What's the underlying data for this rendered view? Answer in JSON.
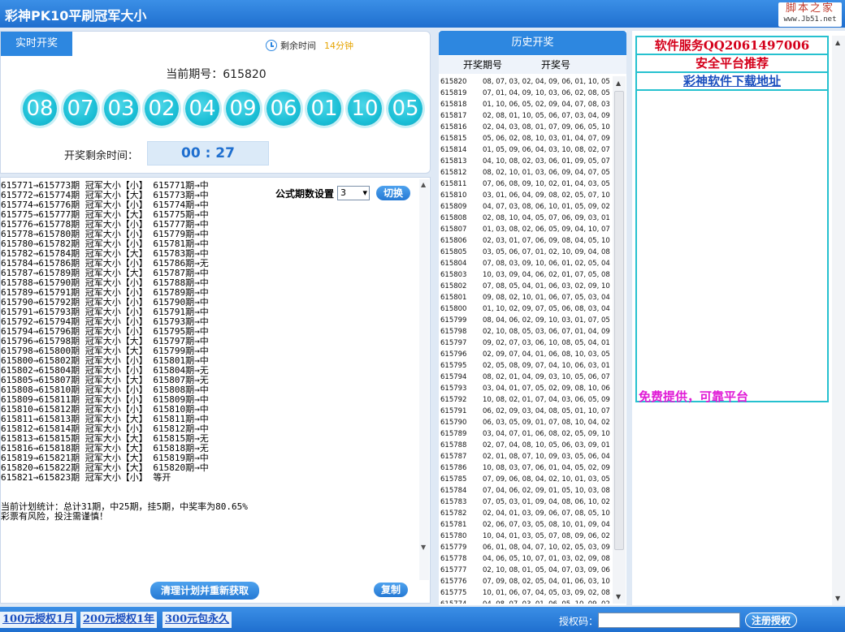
{
  "window": {
    "title": "彩神PK10平刷冠军大小",
    "logo_top": "脚本之家",
    "logo_bottom": "www.Jb51.net"
  },
  "live": {
    "tab_label": "实时开奖",
    "remain_label": "剩余时间",
    "remain_value": "14分钟",
    "current_issue": "当前期号：615820",
    "balls": [
      "08",
      "07",
      "03",
      "02",
      "04",
      "09",
      "06",
      "01",
      "10",
      "05"
    ],
    "countdown_label": "开奖剩余时间：",
    "countdown": "00 : 27"
  },
  "plan": {
    "lines": [
      "615771→615773期 冠军大小【小】 615771期→中",
      "615772→615774期 冠军大小【大】 615773期→中",
      "615774→615776期 冠军大小【小】 615774期→中",
      "615775→615777期 冠军大小【大】 615775期→中",
      "615776→615778期 冠军大小【小】 615777期→中",
      "615778→615780期 冠军大小【小】 615779期→中",
      "615780→615782期 冠军大小【小】 615781期→中",
      "615782→615784期 冠军大小【大】 615783期→中",
      "615784→615786期 冠军大小【小】 615786期→无",
      "615787→615789期 冠军大小【大】 615787期→中",
      "615788→615790期 冠军大小【小】 615788期→中",
      "615789→615791期 冠军大小【小】 615789期→中",
      "615790→615792期 冠军大小【小】 615790期→中",
      "615791→615793期 冠军大小【小】 615791期→中",
      "615792→615794期 冠军大小【小】 615793期→中",
      "615794→615796期 冠军大小【小】 615795期→中",
      "615796→615798期 冠军大小【大】 615797期→中",
      "615798→615800期 冠军大小【大】 615799期→中",
      "615800→615802期 冠军大小【小】 615801期→中",
      "615802→615804期 冠军大小【小】 615804期→无",
      "615805→615807期 冠军大小【大】 615807期→无",
      "615808→615810期 冠军大小【小】 615808期→中",
      "615809→615811期 冠军大小【小】 615809期→中",
      "615810→615812期 冠军大小【小】 615810期→中",
      "615811→615813期 冠军大小【大】 615811期→中",
      "615812→615814期 冠军大小【小】 615812期→中",
      "615813→615815期 冠军大小【大】 615815期→无",
      "615816→615818期 冠军大小【大】 615818期→无",
      "615819→615821期 冠军大小【大】 615819期→中",
      "615820→615822期 冠军大小【大】 615820期→中",
      "615821→615823期 冠军大小【小】 等开"
    ],
    "summary_1": "当前计划统计：总计31期，中25期，挂5期，中奖率为80.65%",
    "summary_2": "彩票有风险，投注需谨慎！",
    "formula_label": "公式期数设置",
    "formula_value": "3",
    "switch_label": "切换",
    "clear_label": "清理计划并重新获取",
    "copy_label": "复制"
  },
  "history": {
    "tab_label": "历史开奖",
    "col_issue": "开奖期号",
    "col_numbers": "开奖号",
    "rows": [
      [
        "615820",
        "08, 07, 03, 02, 04, 09, 06, 01, 10, 05"
      ],
      [
        "615819",
        "07, 01, 04, 09, 10, 03, 06, 02, 08, 05"
      ],
      [
        "615818",
        "01, 10, 06, 05, 02, 09, 04, 07, 08, 03"
      ],
      [
        "615817",
        "02, 08, 01, 10, 05, 06, 07, 03, 04, 09"
      ],
      [
        "615816",
        "02, 04, 03, 08, 01, 07, 09, 06, 05, 10"
      ],
      [
        "615815",
        "05, 06, 02, 08, 10, 03, 01, 04, 07, 09"
      ],
      [
        "615814",
        "01, 05, 09, 06, 04, 03, 10, 08, 02, 07"
      ],
      [
        "615813",
        "04, 10, 08, 02, 03, 06, 01, 09, 05, 07"
      ],
      [
        "615812",
        "08, 02, 10, 01, 03, 06, 09, 04, 07, 05"
      ],
      [
        "615811",
        "07, 06, 08, 09, 10, 02, 01, 04, 03, 05"
      ],
      [
        "615810",
        "03, 01, 06, 04, 09, 08, 02, 05, 07, 10"
      ],
      [
        "615809",
        "04, 07, 03, 08, 06, 10, 01, 05, 09, 02"
      ],
      [
        "615808",
        "02, 08, 10, 04, 05, 07, 06, 09, 03, 01"
      ],
      [
        "615807",
        "01, 03, 08, 02, 06, 05, 09, 04, 10, 07"
      ],
      [
        "615806",
        "02, 03, 01, 07, 06, 09, 08, 04, 05, 10"
      ],
      [
        "615805",
        "03, 05, 06, 07, 01, 02, 10, 09, 04, 08"
      ],
      [
        "615804",
        "07, 08, 03, 09, 10, 06, 01, 02, 05, 04"
      ],
      [
        "615803",
        "10, 03, 09, 04, 06, 02, 01, 07, 05, 08"
      ],
      [
        "615802",
        "07, 08, 05, 04, 01, 06, 03, 02, 09, 10"
      ],
      [
        "615801",
        "09, 08, 02, 10, 01, 06, 07, 05, 03, 04"
      ],
      [
        "615800",
        "01, 10, 02, 09, 07, 05, 06, 08, 03, 04"
      ],
      [
        "615799",
        "08, 04, 06, 02, 09, 10, 03, 01, 07, 05"
      ],
      [
        "615798",
        "02, 10, 08, 05, 03, 06, 07, 01, 04, 09"
      ],
      [
        "615797",
        "09, 02, 07, 03, 06, 10, 08, 05, 04, 01"
      ],
      [
        "615796",
        "02, 09, 07, 04, 01, 06, 08, 10, 03, 05"
      ],
      [
        "615795",
        "02, 05, 08, 09, 07, 04, 10, 06, 03, 01"
      ],
      [
        "615794",
        "08, 02, 01, 04, 09, 03, 10, 05, 06, 07"
      ],
      [
        "615793",
        "03, 04, 01, 07, 05, 02, 09, 08, 10, 06"
      ],
      [
        "615792",
        "10, 08, 02, 01, 07, 04, 03, 06, 05, 09"
      ],
      [
        "615791",
        "06, 02, 09, 03, 04, 08, 05, 01, 10, 07"
      ],
      [
        "615790",
        "06, 03, 05, 09, 01, 07, 08, 10, 04, 02"
      ],
      [
        "615789",
        "03, 04, 07, 01, 06, 08, 02, 05, 09, 10"
      ],
      [
        "615788",
        "02, 07, 04, 08, 10, 05, 06, 03, 09, 01"
      ],
      [
        "615787",
        "02, 01, 08, 07, 10, 09, 03, 05, 06, 04"
      ],
      [
        "615786",
        "10, 08, 03, 07, 06, 01, 04, 05, 02, 09"
      ],
      [
        "615785",
        "07, 09, 06, 08, 04, 02, 10, 01, 03, 05"
      ],
      [
        "615784",
        "07, 04, 06, 02, 09, 01, 05, 10, 03, 08"
      ],
      [
        "615783",
        "07, 05, 03, 01, 09, 04, 08, 06, 10, 02"
      ],
      [
        "615782",
        "02, 04, 01, 03, 09, 06, 07, 08, 05, 10"
      ],
      [
        "615781",
        "02, 06, 07, 03, 05, 08, 10, 01, 09, 04"
      ],
      [
        "615780",
        "10, 04, 01, 03, 05, 07, 08, 09, 06, 02"
      ],
      [
        "615779",
        "06, 01, 08, 04, 07, 10, 02, 05, 03, 09"
      ],
      [
        "615778",
        "04, 06, 05, 10, 07, 01, 03, 02, 09, 08"
      ],
      [
        "615777",
        "02, 10, 08, 01, 05, 04, 07, 03, 09, 06"
      ],
      [
        "615776",
        "07, 09, 08, 02, 05, 04, 01, 06, 03, 10"
      ],
      [
        "615775",
        "10, 01, 06, 07, 04, 05, 03, 09, 02, 08"
      ],
      [
        "615774",
        "04, 08, 07, 03, 01, 06, 05, 10, 09, 02"
      ]
    ]
  },
  "ads": {
    "line_1": "软件服务QQ2061497006",
    "line_2": "安全平台推荐",
    "line_3": "彩神软件下载地址",
    "free": "免费提供，可靠平台"
  },
  "footer": {
    "lic_1": "100元授权1月",
    "lic_2": "200元授权1年",
    "lic_3": "300元包永久",
    "auth_label": "授权码：",
    "register_label": "注册授权"
  }
}
